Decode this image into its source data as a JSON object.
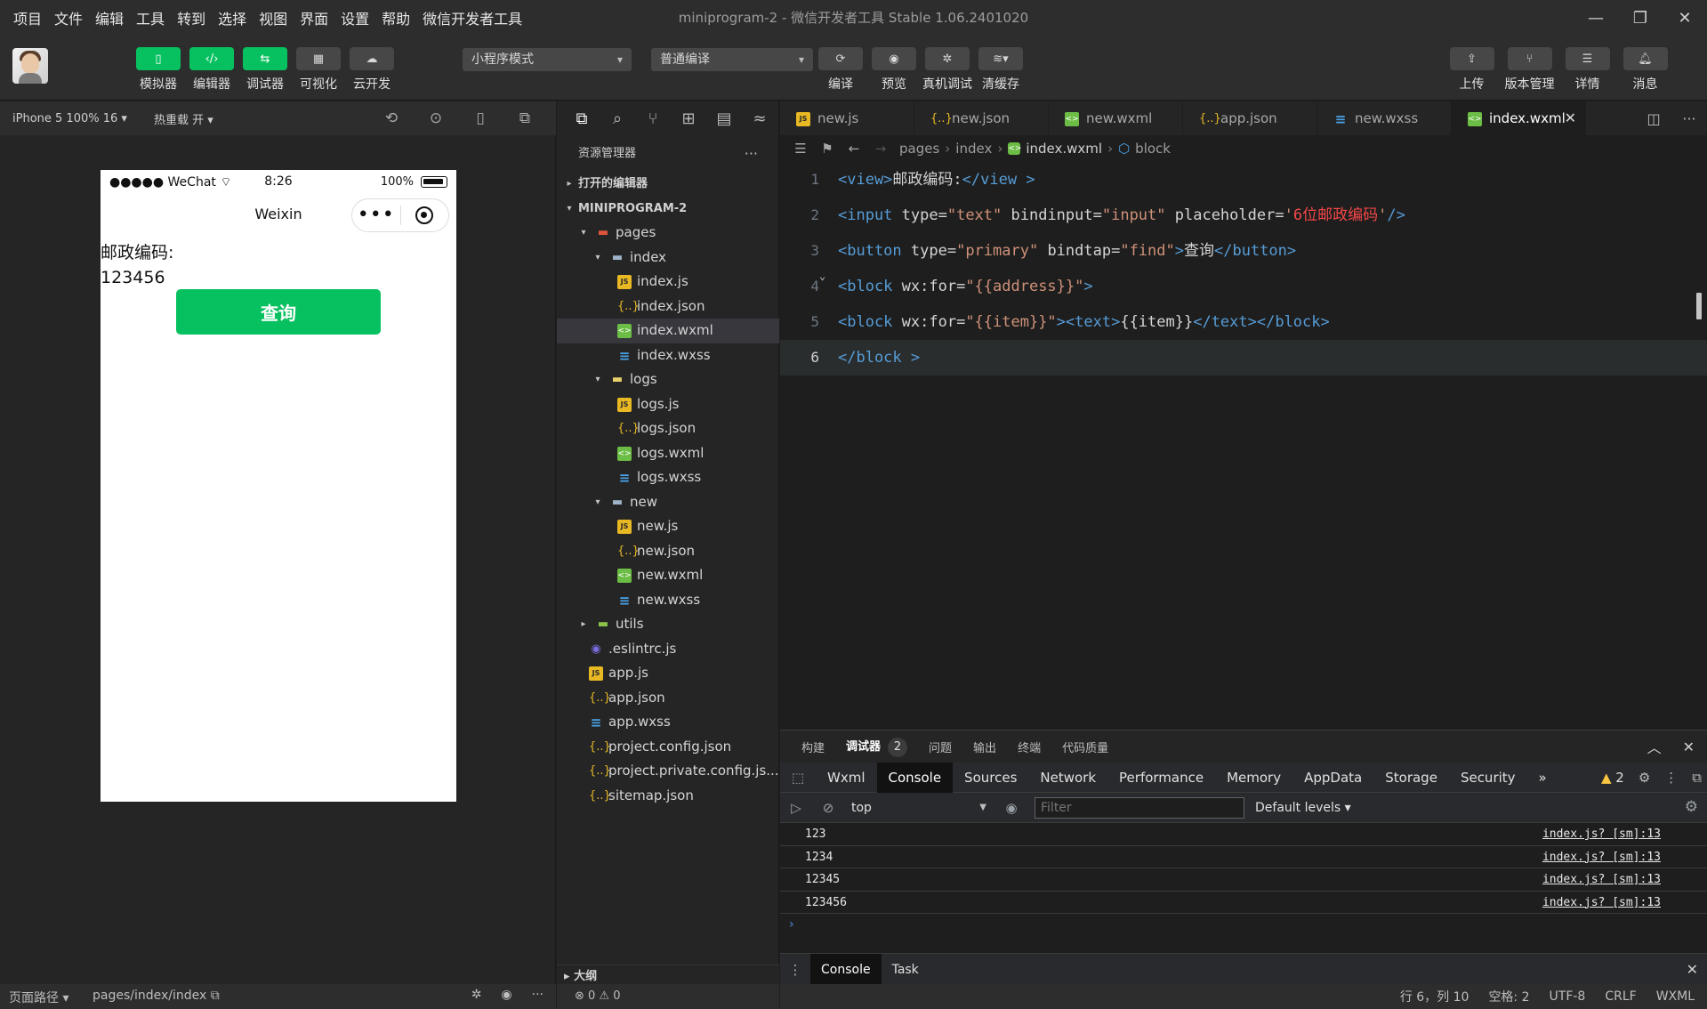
{
  "menu": [
    "项目",
    "文件",
    "编辑",
    "工具",
    "转到",
    "选择",
    "视图",
    "界面",
    "设置",
    "帮助",
    "微信开发者工具"
  ],
  "window_title": "miniprogram-2 - 微信开发者工具 Stable 1.06.2401020",
  "toolbar": {
    "left_tools": [
      "模拟器",
      "编辑器",
      "调试器",
      "可视化",
      "云开发"
    ],
    "mode_select": "小程序模式",
    "compile_select": "普通编译",
    "center_tools": [
      "编译",
      "预览",
      "真机调试",
      "清缓存"
    ],
    "right_tools": [
      "上传",
      "版本管理",
      "详情",
      "消息"
    ]
  },
  "simulator": {
    "device": "iPhone 5 100% 16",
    "hot_reload": "热重载 开",
    "status": {
      "carrier": "●●●●● WeChat",
      "time": "8:26",
      "battery": "100%"
    },
    "nav_title": "Weixin",
    "label": "邮政编码:",
    "input_value": "123456",
    "button": "查询"
  },
  "sim_footer": {
    "path_label": "页面路径",
    "path": "pages/index/index"
  },
  "explorer": {
    "title": "资源管理器",
    "sections": [
      "打开的编辑器",
      "MINIPROGRAM-2"
    ],
    "tree": [
      {
        "name": "pages",
        "type": "folder-pages",
        "depth": 1,
        "open": true
      },
      {
        "name": "index",
        "type": "folder",
        "depth": 2,
        "open": true
      },
      {
        "name": "index.js",
        "type": "js",
        "depth": 3
      },
      {
        "name": "index.json",
        "type": "json",
        "depth": 3
      },
      {
        "name": "index.wxml",
        "type": "wxml",
        "depth": 3,
        "selected": true
      },
      {
        "name": "index.wxss",
        "type": "wxss",
        "depth": 3
      },
      {
        "name": "logs",
        "type": "folder-logs",
        "depth": 2,
        "open": true
      },
      {
        "name": "logs.js",
        "type": "js",
        "depth": 3
      },
      {
        "name": "logs.json",
        "type": "json",
        "depth": 3
      },
      {
        "name": "logs.wxml",
        "type": "wxml",
        "depth": 3
      },
      {
        "name": "logs.wxss",
        "type": "wxss",
        "depth": 3
      },
      {
        "name": "new",
        "type": "folder",
        "depth": 2,
        "open": true
      },
      {
        "name": "new.js",
        "type": "js",
        "depth": 3
      },
      {
        "name": "new.json",
        "type": "json",
        "depth": 3
      },
      {
        "name": "new.wxml",
        "type": "wxml",
        "depth": 3
      },
      {
        "name": "new.wxss",
        "type": "wxss",
        "depth": 3
      },
      {
        "name": "utils",
        "type": "folder-utils",
        "depth": 1,
        "open": false
      },
      {
        "name": ".eslintrc.js",
        "type": "eslint",
        "depth": 1
      },
      {
        "name": "app.js",
        "type": "js",
        "depth": 1
      },
      {
        "name": "app.json",
        "type": "json",
        "depth": 1
      },
      {
        "name": "app.wxss",
        "type": "wxss",
        "depth": 1
      },
      {
        "name": "project.config.json",
        "type": "json",
        "depth": 1
      },
      {
        "name": "project.private.config.js...",
        "type": "json",
        "depth": 1
      },
      {
        "name": "sitemap.json",
        "type": "json",
        "depth": 1
      }
    ],
    "outline": "大纲",
    "footer": "⊗ 0 ⚠ 0"
  },
  "editor": {
    "tabs": [
      {
        "name": "new.js",
        "type": "js"
      },
      {
        "name": "new.json",
        "type": "json"
      },
      {
        "name": "new.wxml",
        "type": "wxml"
      },
      {
        "name": "app.json",
        "type": "json"
      },
      {
        "name": "new.wxss",
        "type": "wxss"
      },
      {
        "name": "index.wxml",
        "type": "wxml",
        "active": true
      }
    ],
    "breadcrumb": [
      "pages",
      "index",
      "index.wxml",
      "block"
    ],
    "code": [
      [
        [
          "t-tag",
          "<view>"
        ],
        [
          "t-txt",
          "邮政编码:"
        ],
        [
          "t-tag",
          "</view >"
        ]
      ],
      [
        [
          "t-tag",
          "<input "
        ],
        [
          "t-attr",
          "type="
        ],
        [
          "t-val",
          "\"text\""
        ],
        [
          "t-attr",
          " bindinput="
        ],
        [
          "t-val",
          "\"input\""
        ],
        [
          "t-attr",
          " placeholder="
        ],
        [
          "t-val",
          "'"
        ],
        [
          "t-red",
          "6位邮政编码"
        ],
        [
          "t-val",
          "'"
        ],
        [
          "t-tag",
          "/>"
        ]
      ],
      [
        [
          "t-tag",
          "<button "
        ],
        [
          "t-attr",
          "type="
        ],
        [
          "t-val",
          "\"primary\""
        ],
        [
          "t-attr",
          " bindtap="
        ],
        [
          "t-val",
          "\"find\""
        ],
        [
          "t-tag",
          ">"
        ],
        [
          "t-txt",
          "查询"
        ],
        [
          "t-tag",
          "</button>"
        ]
      ],
      [
        [
          "t-tag",
          "<block "
        ],
        [
          "t-attr",
          "wx:for="
        ],
        [
          "t-val",
          "\"{{address}}\""
        ],
        [
          "t-tag",
          ">"
        ]
      ],
      [
        [
          "t-tag",
          "<block "
        ],
        [
          "t-attr",
          "wx:for="
        ],
        [
          "t-val",
          "\"{{item}}\""
        ],
        [
          "t-tag",
          "><text>"
        ],
        [
          "t-txt",
          "{{item}}"
        ],
        [
          "t-tag",
          "</text></block>"
        ]
      ],
      [
        [
          "t-tag",
          "</block >"
        ]
      ]
    ],
    "current_line": 6
  },
  "panel": {
    "tabs": [
      "构建",
      "调试器",
      "问题",
      "输出",
      "终端",
      "代码质量"
    ],
    "active_tab": "调试器",
    "badge": "2",
    "devtools_tabs": [
      "Wxml",
      "Console",
      "Sources",
      "Network",
      "Performance",
      "Memory",
      "AppData",
      "Storage",
      "Security"
    ],
    "devtools_active": "Console",
    "more": "»",
    "warnings": "2",
    "context": "top",
    "filter_placeholder": "Filter",
    "levels": "Default levels ▾",
    "logs": [
      {
        "value": "123",
        "source": "index.js? [sm]:13"
      },
      {
        "value": "1234",
        "source": "index.js? [sm]:13"
      },
      {
        "value": "12345",
        "source": "index.js? [sm]:13"
      },
      {
        "value": "123456",
        "source": "index.js? [sm]:13"
      }
    ],
    "prompt": "›",
    "drawer_tabs": [
      "Console",
      "Task"
    ]
  },
  "statusbar": [
    "行 6，列 10",
    "空格: 2",
    "UTF-8",
    "CRLF",
    "WXML"
  ]
}
